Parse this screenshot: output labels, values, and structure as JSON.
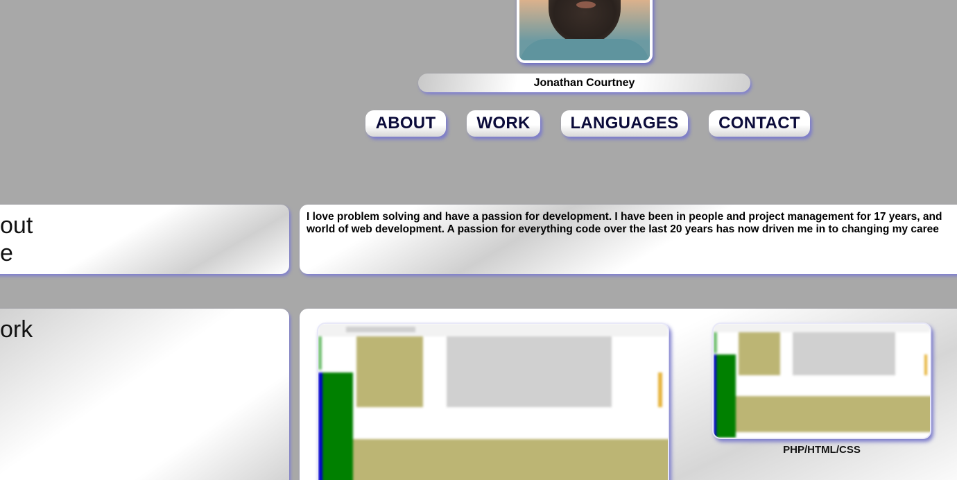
{
  "profile": {
    "name": "Jonathan Courtney"
  },
  "nav": {
    "items": [
      {
        "label": "ABOUT"
      },
      {
        "label": "WORK"
      },
      {
        "label": "LANGUAGES"
      },
      {
        "label": "CONTACT"
      }
    ]
  },
  "about": {
    "heading_line1": "out",
    "heading_line2": "e",
    "text_line1": "I love problem solving and have a passion for development. I have been in people and project management for 17 years, and",
    "text_line2": "world of web development. A passion for everything code over the last 20 years has now driven me in to changing my caree"
  },
  "work": {
    "heading": "ork",
    "projects": [
      {
        "caption": ""
      },
      {
        "caption": "PHP/HTML/CSS"
      }
    ]
  },
  "colors": {
    "background": "#a8a8a8",
    "accent_shadow": "#7f7fcf",
    "nav_text": "#0b0b3a"
  }
}
